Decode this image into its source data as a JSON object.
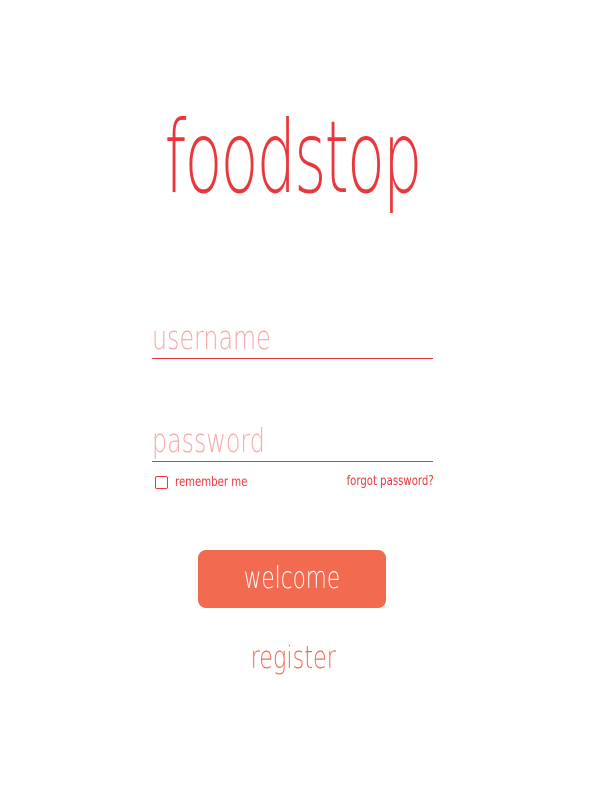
{
  "brand": {
    "logo_text": "foodstop",
    "primary_color": "#e8383d",
    "accent_color": "#f26a4f",
    "placeholder_color": "#f7a8a8"
  },
  "login_form": {
    "username": {
      "value": "",
      "placeholder": "username"
    },
    "password": {
      "value": "",
      "placeholder": "password"
    },
    "remember_me": {
      "label": "remember me",
      "checked": false
    },
    "forgot_password_label": "forgot password?",
    "submit_label": "welcome",
    "register_label": "register"
  }
}
